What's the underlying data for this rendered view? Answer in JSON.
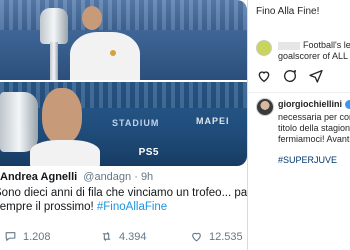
{
  "tweet": {
    "author_name": "Andrea Agnelli",
    "handle": "@andagn",
    "separator": " · ",
    "time": "9h",
    "text_line1": "Sono dieci anni di fila che vinciamo un trofeo... pas mal, ma il più",
    "text_line2_prefix": "sempre il prossimo! ",
    "hashtag": "#FinoAllaFine",
    "images": [
      "ronaldo-with-trophy-photo",
      "chiellini-kissing-trophy-photo"
    ],
    "photo_texts": [
      "STADIUM",
      "MAPEI",
      "PS5"
    ],
    "actions": {
      "replies": "1.208",
      "retweets": "4.394",
      "likes": "12.535"
    },
    "colors": {
      "hashtag": "#1b95e0",
      "retweet_green": "#17bf63",
      "like_red": "#e0245e"
    }
  },
  "instagram": {
    "caption_top": "Fino Alla Fine!",
    "comment1_line1": "Football's leade",
    "comment1_line2": "goalscorer of ALL TIM",
    "username": "giorgiochiellini",
    "caption_lines": [
      "necessaria per conqu",
      "titolo della stagione.",
      "fermiamoci! Avanti c"
    ],
    "hashtag": "#SUPERJUVE",
    "colors": {
      "hashtag": "#00376b",
      "verified": "#3897f0"
    }
  }
}
